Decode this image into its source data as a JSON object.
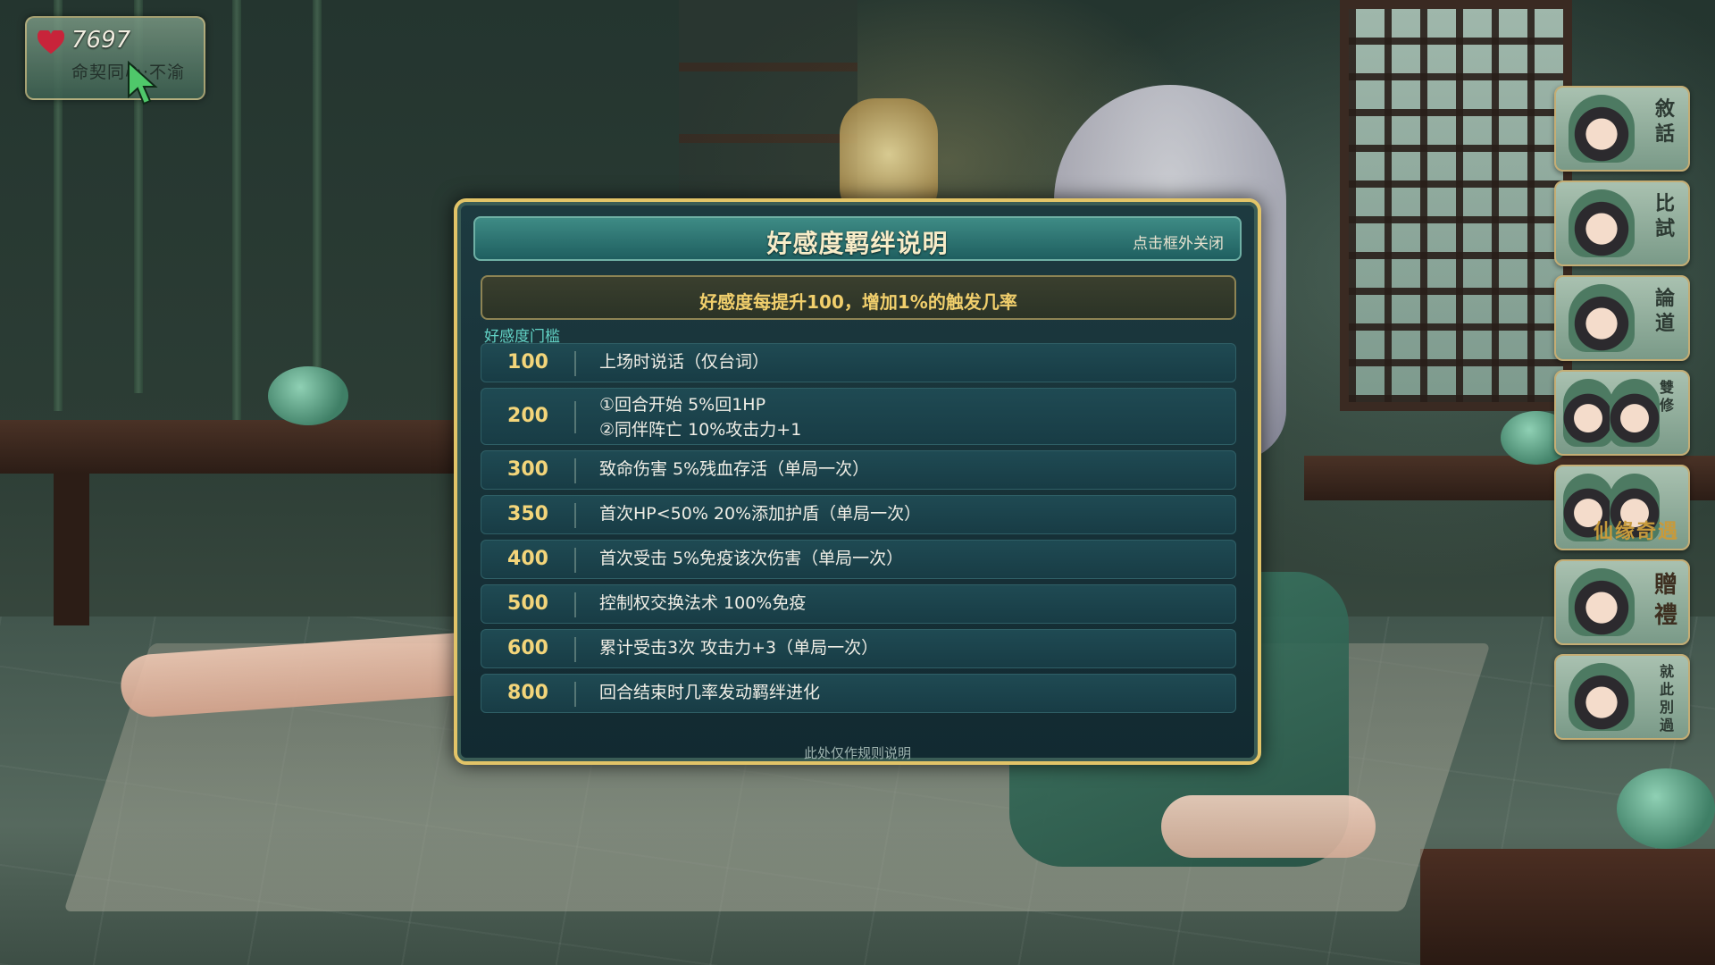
{
  "affection": {
    "value": "7697",
    "status": "命契同心·不渝",
    "heart_color": "#c8243a"
  },
  "side_menu": [
    {
      "label": "敘話"
    },
    {
      "label": "比試"
    },
    {
      "label": "論道"
    },
    {
      "label": "雙修"
    },
    {
      "label": "仙缘奇遇"
    },
    {
      "label": "贈禮"
    },
    {
      "label": "就此別過"
    }
  ],
  "modal": {
    "title": "好感度羁绊说明",
    "close_hint": "点击框外关闭",
    "banner": "好感度每提升100，增加1%的触发几率",
    "section_label": "好感度门槛",
    "rows": [
      {
        "threshold": "100",
        "lines": [
          "上场时说话（仅台词）"
        ]
      },
      {
        "threshold": "200",
        "lines": [
          "①回合开始 5%回1HP",
          "②同伴阵亡 10%攻击力+1"
        ]
      },
      {
        "threshold": "300",
        "lines": [
          "致命伤害 5%残血存活（单局一次）"
        ]
      },
      {
        "threshold": "350",
        "lines": [
          "首次HP<50% 20%添加护盾（单局一次）"
        ]
      },
      {
        "threshold": "400",
        "lines": [
          "首次受击 5%免疫该次伤害（单局一次）"
        ]
      },
      {
        "threshold": "500",
        "lines": [
          "控制权交换法术 100%免疫"
        ]
      },
      {
        "threshold": "600",
        "lines": [
          "累计受击3次 攻击力+3（单局一次）"
        ]
      },
      {
        "threshold": "800",
        "lines": [
          "回合结束时几率发动羁绊进化"
        ]
      }
    ],
    "footnote": "此处仅作规则说明"
  },
  "colors": {
    "modal_border": "#e2c468",
    "threshold_text": "#f3d57a",
    "banner_text": "#f1cf6c",
    "section_label": "#62d2c5"
  }
}
